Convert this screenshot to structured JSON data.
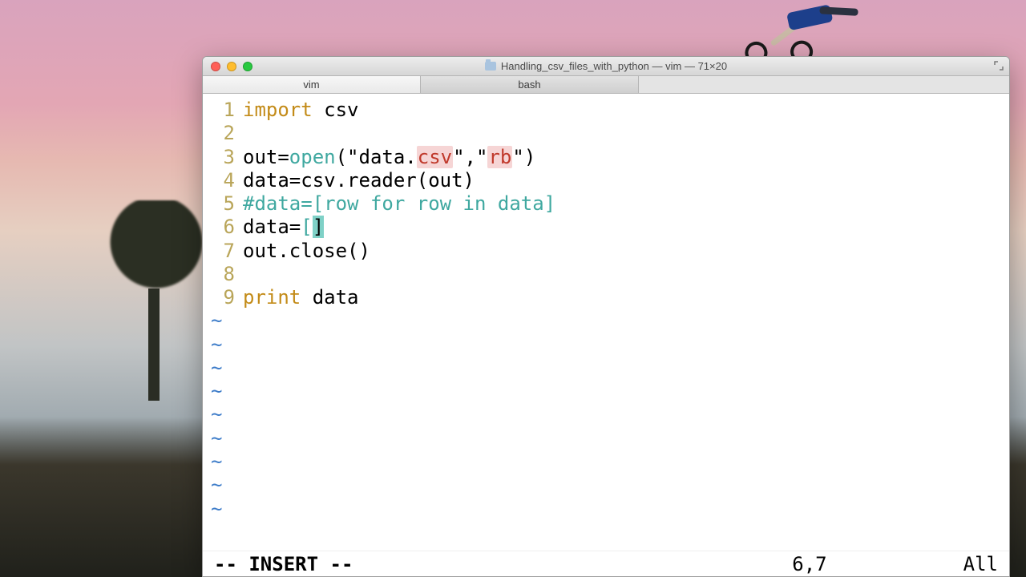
{
  "window": {
    "title": "Handling_csv_files_with_python — vim — 71×20"
  },
  "tabs": [
    {
      "label": "vim",
      "active": true
    },
    {
      "label": "bash",
      "active": false
    }
  ],
  "code": {
    "lines": [
      {
        "n": "1",
        "segments": [
          {
            "t": "import",
            "c": "kw"
          },
          {
            "t": " csv",
            "c": ""
          }
        ]
      },
      {
        "n": "2",
        "segments": [
          {
            "t": "",
            "c": ""
          }
        ]
      },
      {
        "n": "3",
        "segments": [
          {
            "t": "out=",
            "c": ""
          },
          {
            "t": "open",
            "c": "fn"
          },
          {
            "t": "(\"data.",
            "c": ""
          },
          {
            "t": "csv",
            "c": "strred"
          },
          {
            "t": "\",\"",
            "c": ""
          },
          {
            "t": "rb",
            "c": "strred"
          },
          {
            "t": "\")",
            "c": ""
          }
        ]
      },
      {
        "n": "4",
        "segments": [
          {
            "t": "data=csv.reader(out)",
            "c": ""
          }
        ]
      },
      {
        "n": "5",
        "segments": [
          {
            "t": "#data=[row for row in data]",
            "c": "cmt"
          }
        ]
      },
      {
        "n": "6",
        "segments": [
          {
            "t": "data=",
            "c": ""
          },
          {
            "t": "[",
            "c": "cmt"
          },
          {
            "t": "]",
            "c": "cursor-cell"
          }
        ]
      },
      {
        "n": "7",
        "segments": [
          {
            "t": "out.close()",
            "c": ""
          }
        ]
      },
      {
        "n": "8",
        "segments": [
          {
            "t": "",
            "c": ""
          }
        ]
      },
      {
        "n": "9",
        "segments": [
          {
            "t": "print",
            "c": "kw"
          },
          {
            "t": " data",
            "c": ""
          }
        ]
      }
    ],
    "tilde": "~",
    "tilde_rows": 9
  },
  "status": {
    "mode": "-- INSERT --",
    "position": "6,7",
    "percent": "All"
  }
}
